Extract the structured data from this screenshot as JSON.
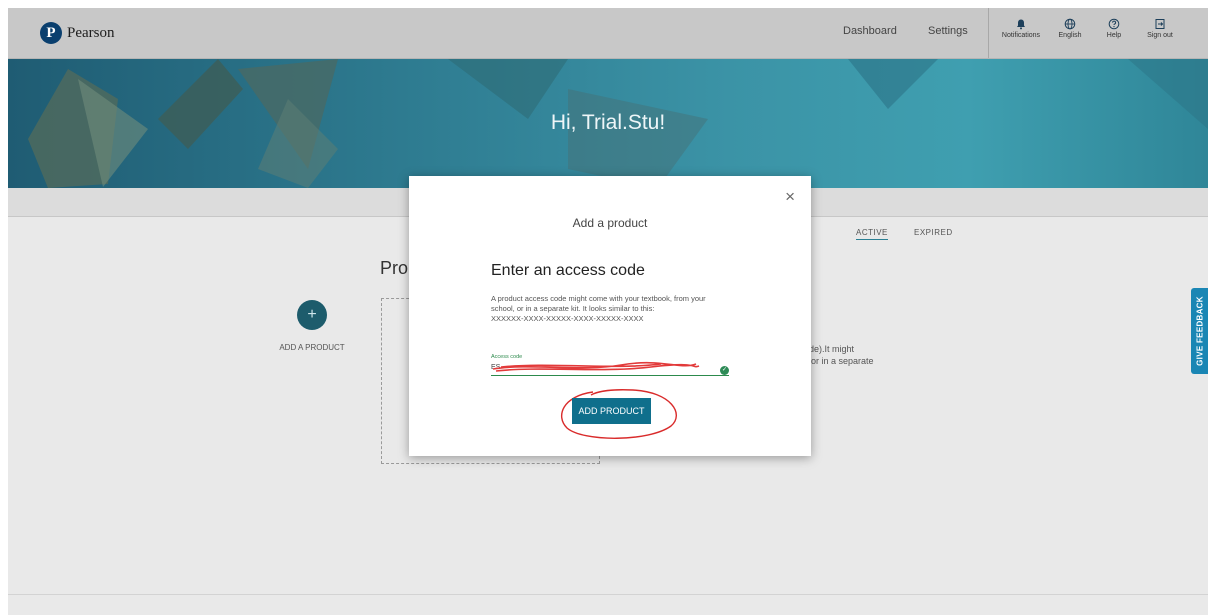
{
  "header": {
    "brand": "Pearson",
    "brand_initial": "P",
    "nav": [
      "Dashboard",
      "Settings"
    ],
    "icons": [
      {
        "label": "Notifications",
        "icon": "bell-icon"
      },
      {
        "label": "English",
        "icon": "globe-icon"
      },
      {
        "label": "Help",
        "icon": "help-icon"
      },
      {
        "label": "Sign out",
        "icon": "sign-out-icon"
      }
    ]
  },
  "hero": {
    "greeting": "Hi, Trial.Stu!"
  },
  "background": {
    "tabs": [
      "ACTIVE",
      "EXPIRED"
    ],
    "section_title": "Pro",
    "add_icon": "+",
    "add_label": "ADD A PRODUCT",
    "partial_text_1": "ode).It might",
    "partial_text_2": "l, or in a separate",
    "feedback": "GIVE FEEDBACK"
  },
  "modal": {
    "close_icon": "×",
    "title": "Add a product",
    "heading": "Enter an access code",
    "description": "A product access code might come with your textbook, from your school, or in a separate kit. It looks similar to this:",
    "example": "XXXXXX-XXXX-XXXXX-XXXX-XXXXX-XXXX",
    "field_label": "Access code",
    "field_value": "ES",
    "check_icon": "✓",
    "button": "ADD PRODUCT"
  },
  "colors": {
    "brand": "#0a3f6e",
    "primary_button": "#0f6f8c",
    "valid_green": "#2e8b57",
    "feedback_tab": "#1a86b4"
  }
}
